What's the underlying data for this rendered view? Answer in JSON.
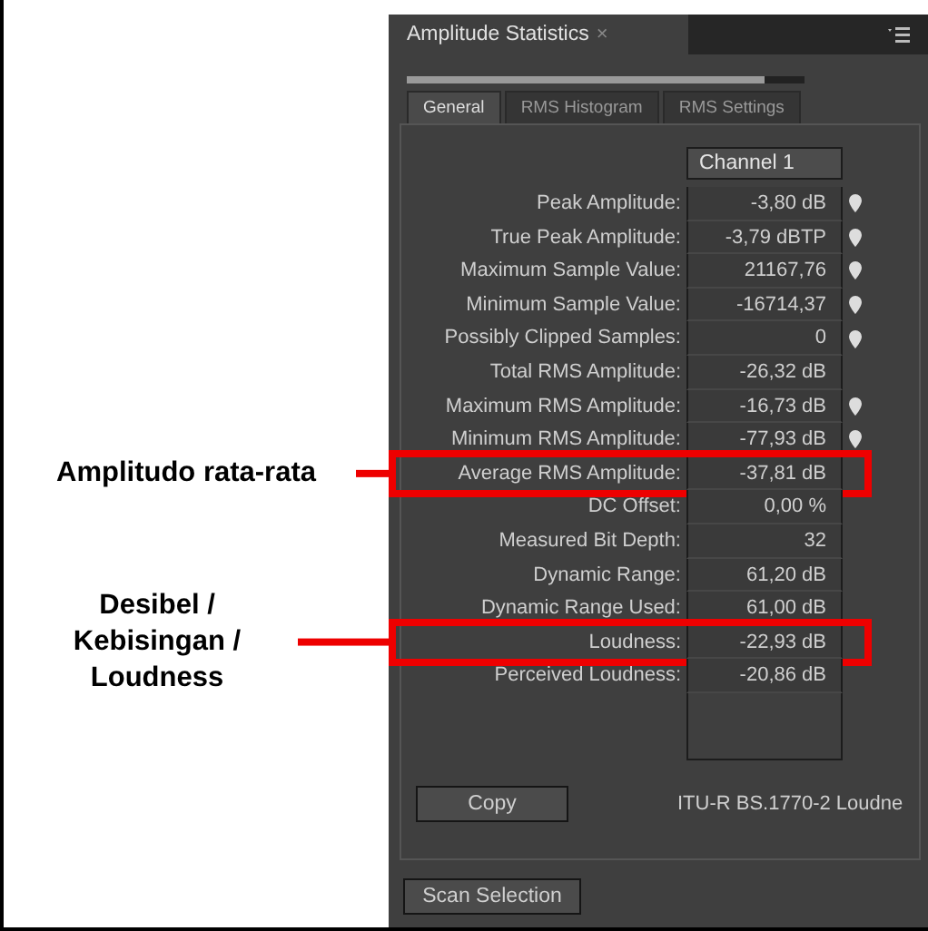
{
  "panel": {
    "title": "Amplitude Statistics",
    "close": "×"
  },
  "progress": {
    "level": 0.9
  },
  "tabs": [
    {
      "label": "General",
      "selected": true
    },
    {
      "label": "RMS Histogram",
      "selected": false
    },
    {
      "label": "RMS Settings",
      "selected": false
    }
  ],
  "column": "Channel 1",
  "rows": [
    {
      "label": "Peak Amplitude:",
      "value": "-3,80 dB",
      "marker": true
    },
    {
      "label": "True Peak Amplitude:",
      "value": "-3,79 dBTP",
      "marker": true
    },
    {
      "label": "Maximum Sample Value:",
      "value": "21167,76",
      "marker": true
    },
    {
      "label": "Minimum Sample Value:",
      "value": "-16714,37",
      "marker": true
    },
    {
      "label": "Possibly Clipped Samples:",
      "value": "0",
      "marker": true
    },
    {
      "label": "Total RMS Amplitude:",
      "value": "-26,32 dB",
      "marker": false
    },
    {
      "label": "Maximum RMS Amplitude:",
      "value": "-16,73 dB",
      "marker": true
    },
    {
      "label": "Minimum RMS Amplitude:",
      "value": "-77,93 dB",
      "marker": true
    },
    {
      "label": "Average RMS Amplitude:",
      "value": "-37,81 dB",
      "marker": false,
      "callout": "Amplitudo rata-rata"
    },
    {
      "label": "DC Offset:",
      "value": "0,00 %",
      "marker": false
    },
    {
      "label": "Measured Bit Depth:",
      "value": "32",
      "marker": false
    },
    {
      "label": "Dynamic Range:",
      "value": "61,20 dB",
      "marker": false
    },
    {
      "label": "Dynamic Range Used:",
      "value": "61,00 dB",
      "marker": false
    },
    {
      "label": "Loudness:",
      "value": "-22,93 dB",
      "marker": false,
      "callout": "Desibel / Kebisingan / Loudness"
    },
    {
      "label": "Perceived Loudness:",
      "value": "-20,86 dB",
      "marker": false
    }
  ],
  "copy_button": "Copy",
  "standard": "ITU-R BS.1770-2 Loudne",
  "scan_button": "Scan Selection"
}
